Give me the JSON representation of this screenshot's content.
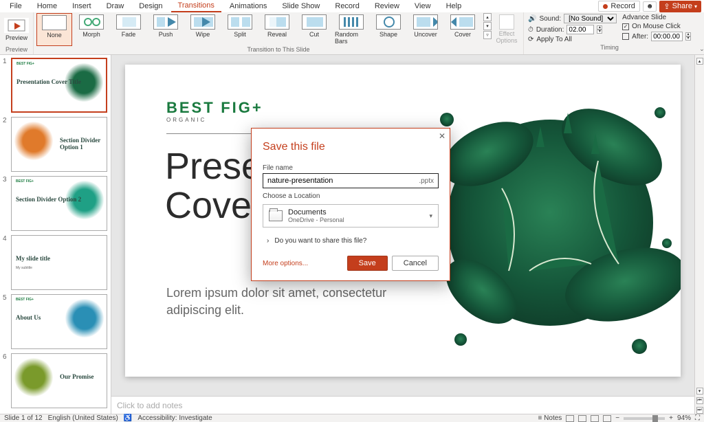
{
  "menubar": {
    "tabs": [
      "File",
      "Home",
      "Insert",
      "Draw",
      "Design",
      "Transitions",
      "Animations",
      "Slide Show",
      "Record",
      "Review",
      "View",
      "Help"
    ],
    "active_index": 5,
    "record_label": "Record",
    "share_label": "Share"
  },
  "ribbon": {
    "preview_label": "Preview",
    "preview_group": "Preview",
    "transitions": [
      "None",
      "Morph",
      "Fade",
      "Push",
      "Wipe",
      "Split",
      "Reveal",
      "Cut",
      "Random Bars",
      "Shape",
      "Uncover",
      "Cover"
    ],
    "selected_transition_index": 0,
    "transition_group": "Transition to This Slide",
    "effect_options": "Effect Options",
    "timing": {
      "sound_label": "Sound:",
      "sound_value": "[No Sound]",
      "duration_label": "Duration:",
      "duration_value": "02.00",
      "apply_all": "Apply To All",
      "advance_label": "Advance Slide",
      "on_mouse": "On Mouse Click",
      "after_label": "After:",
      "after_value": "00:00.00",
      "group": "Timing"
    }
  },
  "thumbnails": [
    {
      "num": "1",
      "title": "Presentation Cover Title",
      "logo": "BEST FIG+",
      "selected": true,
      "splash_color": "#1a6b44",
      "splash_side": "right"
    },
    {
      "num": "2",
      "title": "Section Divider Option 1",
      "logo": "",
      "splash_color": "#e07a2b",
      "splash_side": "left"
    },
    {
      "num": "3",
      "title": "Section Divider Option 2",
      "logo": "BEST FIG+",
      "splash_color": "#1fa085",
      "splash_side": "right"
    },
    {
      "num": "4",
      "title": "My slide title",
      "sub": "My subtitle",
      "logo": "",
      "splash_color": "",
      "splash_side": ""
    },
    {
      "num": "5",
      "title": "About Us",
      "logo": "BEST FIG+",
      "splash_color": "#2a8fb5",
      "splash_side": "right"
    },
    {
      "num": "6",
      "title": "Our Promise",
      "logo": "",
      "splash_color": "#7a9a2b",
      "splash_side": "left"
    }
  ],
  "slide": {
    "logo": "BEST",
    "logo_suffix": "FIG+",
    "logo_sub": "ORGANIC",
    "title_line1": "Presentation",
    "title_line2_pre": "Cover ",
    "title_line2_em": "Title",
    "subtitle": "Lorem ipsum dolor sit amet, consectetur adipiscing elit."
  },
  "notes_placeholder": "Click to add notes",
  "statusbar": {
    "slide_pos": "Slide 1 of 12",
    "lang": "English (United States)",
    "access": "Accessibility: Investigate",
    "notes_btn": "Notes",
    "zoom_pct": "94%"
  },
  "dialog": {
    "title": "Save this file",
    "file_name_label": "File name",
    "file_name_value": "nature-presentation",
    "file_ext": ".pptx",
    "location_label": "Choose a Location",
    "location_name": "Documents",
    "location_sub": "OneDrive - Personal",
    "share_prompt": "Do you want to share this file?",
    "more_options": "More options...",
    "save_label": "Save",
    "cancel_label": "Cancel"
  }
}
